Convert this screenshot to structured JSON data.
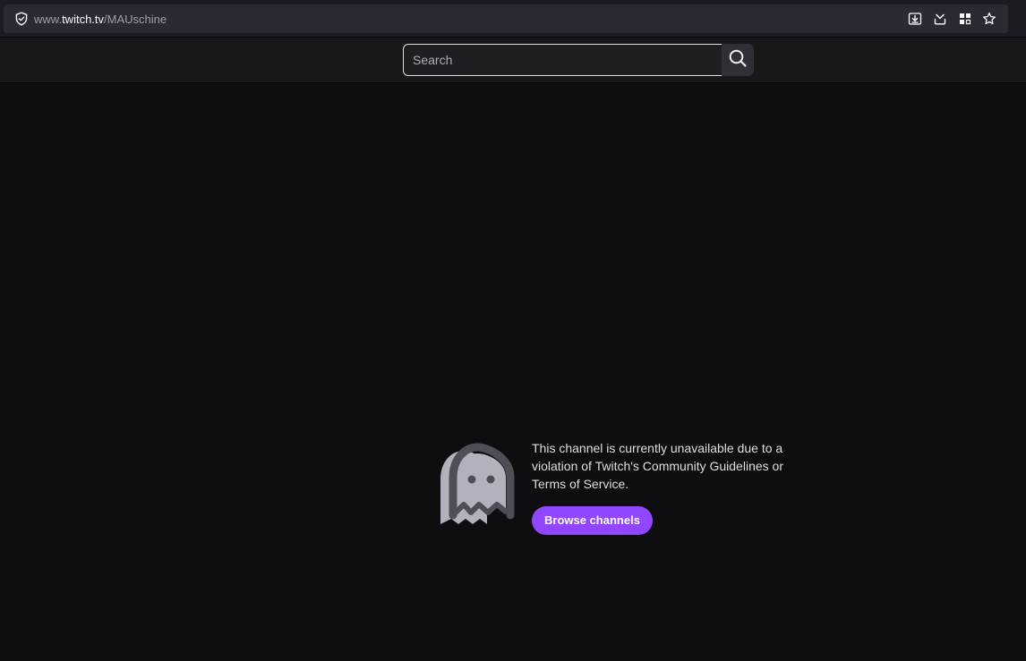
{
  "browser": {
    "url_prefix": "www.",
    "url_domain": "twitch.tv",
    "url_path": "/MAUschine",
    "icons": [
      "shield-icon",
      "download-icon",
      "pocket-icon",
      "extensions-icon",
      "bookmark-star-icon"
    ]
  },
  "nav": {
    "search_placeholder": "Search",
    "search_icon": "search-icon"
  },
  "main": {
    "message": "This channel is currently unavailable due to a violation of Twitch's Community Guidelines or Terms of Service.",
    "browse_label": "Browse channels",
    "illustration": "ghost-icon"
  },
  "colors": {
    "accent": "#9147ff",
    "background": "#0e0e10",
    "nav_background": "#18181b",
    "browser_bar": "#1c1b22"
  }
}
